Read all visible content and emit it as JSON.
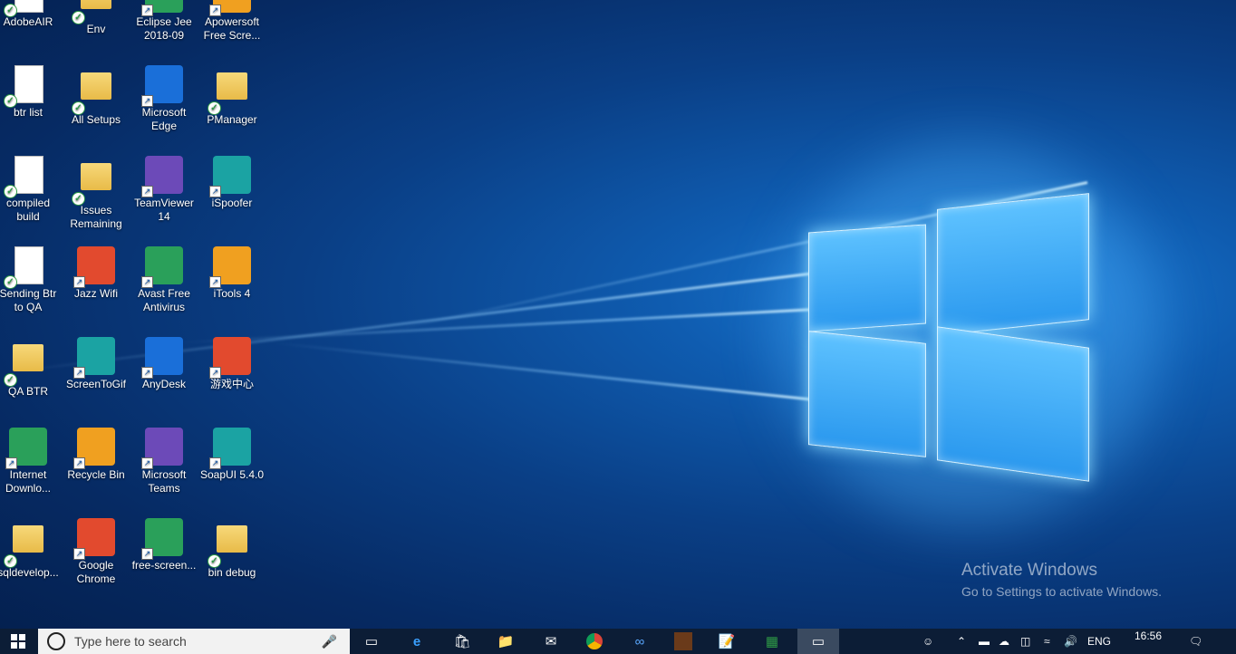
{
  "desktop": {
    "icons": [
      {
        "name": "icon-adobeair",
        "label": "AdobeAIR",
        "kind": "doc"
      },
      {
        "name": "icon-env",
        "label": "Env",
        "kind": "folder"
      },
      {
        "name": "icon-eclipse-jee",
        "label": "Eclipse Jee 2018-09",
        "kind": "app"
      },
      {
        "name": "icon-apowersoft",
        "label": "Apowersoft Free Scre...",
        "kind": "app"
      },
      {
        "name": "icon-btr-list",
        "label": "btr list",
        "kind": "doc"
      },
      {
        "name": "icon-all-setups",
        "label": "All Setups",
        "kind": "folder"
      },
      {
        "name": "icon-microsoft-edge",
        "label": "Microsoft Edge",
        "kind": "app"
      },
      {
        "name": "icon-pmanager",
        "label": "PManager",
        "kind": "folder"
      },
      {
        "name": "icon-compiled-build",
        "label": "compiled build",
        "kind": "doc"
      },
      {
        "name": "icon-issues-remaining",
        "label": "Issues Remaining",
        "kind": "folder"
      },
      {
        "name": "icon-teamviewer",
        "label": "TeamViewer 14",
        "kind": "app"
      },
      {
        "name": "icon-ispoofer",
        "label": "iSpoofer",
        "kind": "app"
      },
      {
        "name": "icon-sending-btr",
        "label": "Sending Btr to QA",
        "kind": "doc"
      },
      {
        "name": "icon-jazz-wifi",
        "label": "Jazz Wifi",
        "kind": "app"
      },
      {
        "name": "icon-avast",
        "label": "Avast Free Antivirus",
        "kind": "app"
      },
      {
        "name": "icon-itools",
        "label": "iTools 4",
        "kind": "app"
      },
      {
        "name": "icon-qa-btr",
        "label": "QA BTR",
        "kind": "folder"
      },
      {
        "name": "icon-screentogif",
        "label": "ScreenToGif",
        "kind": "app"
      },
      {
        "name": "icon-anydesk",
        "label": "AnyDesk",
        "kind": "app"
      },
      {
        "name": "icon-game-center",
        "label": "游戏中心",
        "kind": "app"
      },
      {
        "name": "icon-internet-download",
        "label": "Internet Downlo...",
        "kind": "app"
      },
      {
        "name": "icon-recycle-bin",
        "label": "Recycle Bin",
        "kind": "app"
      },
      {
        "name": "icon-microsoft-teams",
        "label": "Microsoft Teams",
        "kind": "app"
      },
      {
        "name": "icon-soapui",
        "label": "SoapUI 5.4.0",
        "kind": "app"
      },
      {
        "name": "icon-sqldeveloper",
        "label": "sqldevelop...",
        "kind": "folder"
      },
      {
        "name": "icon-google-chrome",
        "label": "Google Chrome",
        "kind": "app"
      },
      {
        "name": "icon-free-screen",
        "label": "free-screen...",
        "kind": "app"
      },
      {
        "name": "icon-bin-debug",
        "label": "bin debug",
        "kind": "folder"
      }
    ]
  },
  "watermark": {
    "title": "Activate Windows",
    "subtitle": "Go to Settings to activate Windows."
  },
  "taskbar": {
    "search_placeholder": "Type here to search",
    "language": "ENG",
    "time": "16:56"
  },
  "colors": {
    "taskbar_bg": "#0c1d36",
    "desktop_blue": "#0a3f86"
  }
}
